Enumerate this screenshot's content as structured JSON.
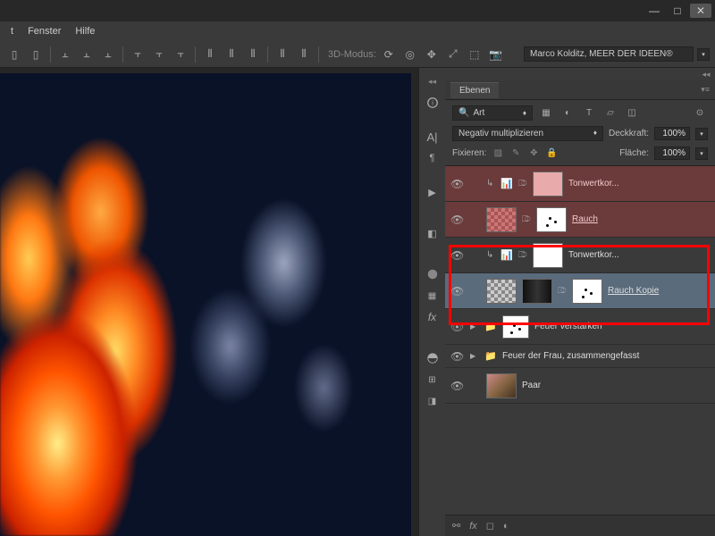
{
  "menu": {
    "fenster": "Fenster",
    "hilfe": "Hilfe"
  },
  "optbar": {
    "mode3d_label": "3D-Modus:",
    "credit": "Marco Kolditz, MEER DER IDEEN®"
  },
  "panel": {
    "title": "Ebenen",
    "search_kind": "Art",
    "blend_mode": "Negativ multiplizieren",
    "opacity_label": "Deckkraft:",
    "opacity_value": "100%",
    "lock_label": "Fixieren:",
    "fill_label": "Fläche:",
    "fill_value": "100%"
  },
  "layers": [
    {
      "type": "clipadj",
      "name": "Tonwertkor...",
      "variant": "red"
    },
    {
      "type": "img",
      "name": "Rauch",
      "variant": "red",
      "underline": true
    },
    {
      "type": "clipadj",
      "name": "Tonwertkor...",
      "variant": "plain"
    },
    {
      "type": "img",
      "name": "Rauch Kopie",
      "variant": "sel",
      "underline": true
    },
    {
      "type": "group",
      "name": "Feuer verstärken"
    },
    {
      "type": "groupsm",
      "name": "Feuer der Frau, zusammengefasst"
    },
    {
      "type": "photo",
      "name": "Paar"
    }
  ]
}
